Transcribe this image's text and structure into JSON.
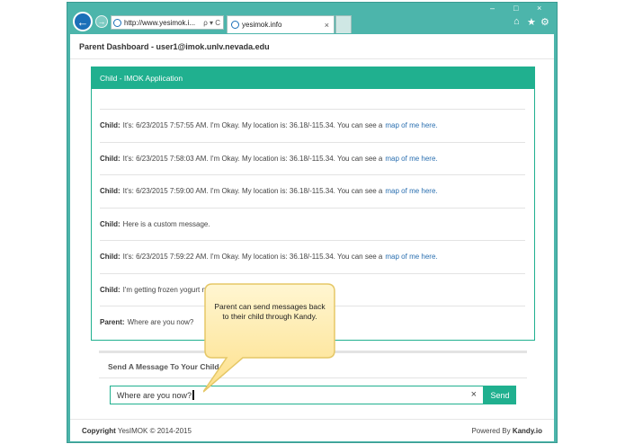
{
  "browser": {
    "address_url": "http://www.yesimok.i...",
    "address_actions": "ρ ▾ C",
    "tab_title": "yesimok.info",
    "tab_close": "×",
    "window_controls": [
      "–",
      "□",
      "×"
    ],
    "tool_icons": [
      "home-icon",
      "star-icon",
      "gear-icon"
    ]
  },
  "dashboard": {
    "title": "Parent Dashboard - user1@imok.unlv.nevada.edu"
  },
  "panel": {
    "title": "Child - IMOK Application",
    "messages": [
      {
        "sender": "Child:",
        "text": "It's: 6/23/2015 7:57:55 AM. I'm Okay. My location is: 36.18/-115.34. You can see a",
        "link": "map of me here."
      },
      {
        "sender": "Child:",
        "text": "It's: 6/23/2015 7:58:03 AM. I'm Okay. My location is: 36.18/-115.34. You can see a",
        "link": "map of me here."
      },
      {
        "sender": "Child:",
        "text": "It's: 6/23/2015 7:59:00 AM. I'm Okay. My location is: 36.18/-115.34. You can see a",
        "link": "map of me here."
      },
      {
        "sender": "Child:",
        "text": "Here is a custom message.",
        "link": ""
      },
      {
        "sender": "Child:",
        "text": "It's: 6/23/2015 7:59:22 AM. I'm Okay. My location is: 36.18/-115.34. You can see a",
        "link": "map of me here."
      },
      {
        "sender": "Child:",
        "text": "I'm getting frozen yogurt no",
        "link": ""
      },
      {
        "sender": "Parent:",
        "text": "Where are you now?",
        "link": ""
      }
    ]
  },
  "send": {
    "title": "Send A Message To Your Child",
    "input_value": "Where are you now?",
    "clear_label": "×",
    "button_label": "Send"
  },
  "footer": {
    "copyright_label": "Copyright",
    "copyright_text": "YesIMOK © 2014-2015",
    "powered_text": "Powered By",
    "powered_brand": "Kandy.io"
  },
  "callout": {
    "text": "Parent can send messages back to their child through Kandy."
  },
  "colors": {
    "accent": "#20b08f",
    "browser_frame": "#4cb5ab",
    "link": "#2a6fb0",
    "callout_fill": "#fde9a6"
  }
}
